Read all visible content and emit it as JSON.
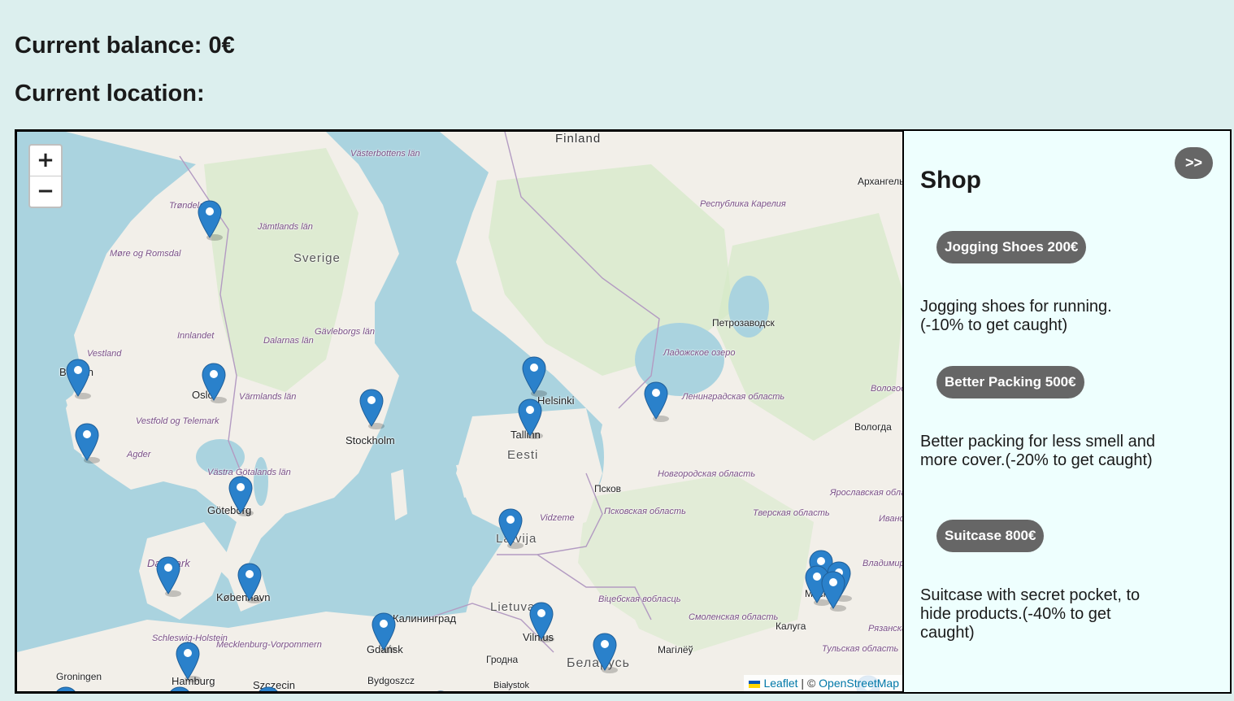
{
  "balance_label": "Current balance: 0€",
  "location_label": "Current location:",
  "map": {
    "zoom_in": "+",
    "zoom_out": "−",
    "attribution": {
      "leaflet": "Leaflet",
      "separator": " | © ",
      "osm": "OpenStreetMap"
    },
    "labels": [
      {
        "text": "Finland"
      },
      {
        "text": "Sverige"
      },
      {
        "text": "Eesti"
      },
      {
        "text": "Latvija"
      },
      {
        "text": "Lietuva"
      },
      {
        "text": "Беларусь"
      },
      {
        "text": "Stockholm"
      },
      {
        "text": "Oslo"
      },
      {
        "text": "Göteborg"
      },
      {
        "text": "København"
      },
      {
        "text": "Tallinn"
      },
      {
        "text": "Helsinki"
      },
      {
        "text": "Gdańsk"
      },
      {
        "text": "Vilnius"
      },
      {
        "text": "Калининград"
      },
      {
        "text": "Москва"
      },
      {
        "text": "Псков"
      },
      {
        "text": "Петрозаводск"
      },
      {
        "text": "Вологда"
      },
      {
        "text": "Калуга"
      },
      {
        "text": "Гродна"
      },
      {
        "text": "Магілёў"
      },
      {
        "text": "Bydgoszcz"
      },
      {
        "text": "Groningen"
      },
      {
        "text": "Szczecin"
      },
      {
        "text": "Hamburg"
      },
      {
        "text": "Bergen"
      },
      {
        "text": "Trøndelag"
      },
      {
        "text": "Архангельск"
      },
      {
        "text": "Jämtlands län"
      },
      {
        "text": "Västerbottens län"
      },
      {
        "text": "Innlandet"
      },
      {
        "text": "Dalarnas län"
      },
      {
        "text": "Gävleborgs län"
      },
      {
        "text": "Värmlands län"
      },
      {
        "text": "Vestfold og Telemark"
      },
      {
        "text": "Agder"
      },
      {
        "text": "Møre og Romsdal"
      },
      {
        "text": "Vestland"
      },
      {
        "text": "Västra Götalands län"
      },
      {
        "text": "Danmark"
      },
      {
        "text": "Mecklenburg-Vorpommern"
      },
      {
        "text": "Schleswig-Holstein"
      },
      {
        "text": "Vidzeme"
      },
      {
        "text": "Республика Карелия"
      },
      {
        "text": "Ладожское озеро"
      },
      {
        "text": "Ленинградская область"
      },
      {
        "text": "Новгородская область"
      },
      {
        "text": "Псковская область"
      },
      {
        "text": "Тверская область"
      },
      {
        "text": "Ярославская область"
      },
      {
        "text": "Смоленская область"
      },
      {
        "text": "Віцебская вобласць"
      },
      {
        "text": "Тульская область"
      },
      {
        "text": "Владимирская область"
      },
      {
        "text": "Рязанская область"
      },
      {
        "text": "Вологодская область"
      },
      {
        "text": "Ивановская область"
      },
      {
        "text": "Białystok"
      }
    ]
  },
  "shop": {
    "toggle_label": ">>",
    "title": "Shop",
    "items": [
      {
        "button": "Jogging Shoes 200€",
        "description": "Jogging shoes for running.(-10% to get caught)"
      },
      {
        "button": "Better Packing 500€",
        "description": "Better packing for less smell and more cover.(-20% to get caught)"
      },
      {
        "button": "Suitcase 800€",
        "description": "Suitcase with secret pocket, to hide products.(-40% to get caught)"
      }
    ]
  },
  "colors": {
    "page_bg": "#dcefee",
    "panel_bg": "#eefffe",
    "button_bg": "#666666",
    "water": "#aad3df",
    "land": "#f2efe9",
    "forest": "#cfe6bf",
    "marker": "#2a81cb"
  },
  "marker_icon": "map-marker-icon"
}
